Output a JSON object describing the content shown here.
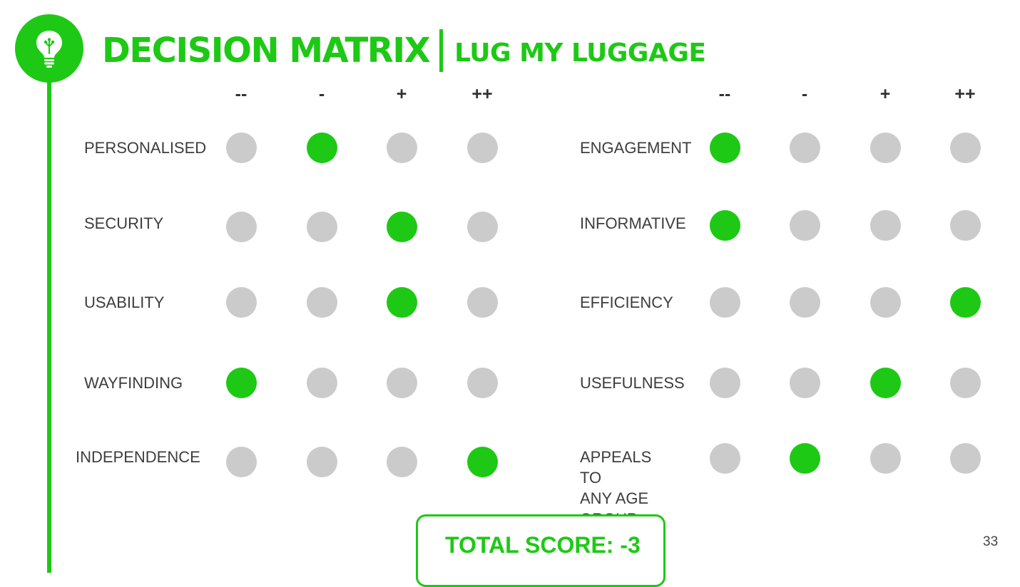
{
  "header": {
    "title": "DECISION MATRIX",
    "subtitle": "LUG MY LUGGAGE",
    "logo_icon": "lightbulb-icon"
  },
  "scale": [
    "--",
    "-",
    "+",
    "++"
  ],
  "matrix": {
    "left": [
      {
        "label": "PERSONALISED",
        "selected": 1
      },
      {
        "label": "SECURITY",
        "selected": 2
      },
      {
        "label": "USABILITY",
        "selected": 2
      },
      {
        "label": "WAYFINDING",
        "selected": 0
      },
      {
        "label": "INDEPENDENCE",
        "selected": 3
      }
    ],
    "right": [
      {
        "label": "ENGAGEMENT",
        "selected": 0
      },
      {
        "label": "INFORMATIVE",
        "selected": 0
      },
      {
        "label": "EFFICIENCY",
        "selected": 3
      },
      {
        "label": "USEFULNESS",
        "selected": 2
      },
      {
        "label": "APPEALS TO\nANY AGE GROUP",
        "selected": 1
      }
    ]
  },
  "total": {
    "text": "TOTAL SCORE: -3"
  },
  "page_number": "33",
  "colors": {
    "accent": "#1dc914",
    "unselected": "#cbcbcb",
    "text": "#3d3d3d"
  }
}
